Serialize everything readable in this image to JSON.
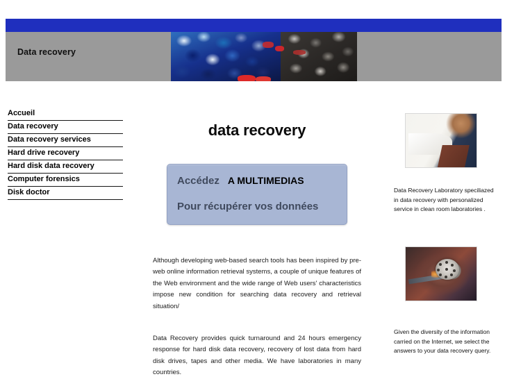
{
  "header": {
    "site_title": "Data recovery",
    "blue_bar_color": "#1f2fbe",
    "band_color": "#9a9a9a",
    "mosaic_image_name": "crowd-mosaic-banner"
  },
  "sidebar": {
    "items": [
      {
        "label": "Accueil"
      },
      {
        "label": "Data recovery"
      },
      {
        "label": "Data recovery services"
      },
      {
        "label": "Hard drive recovery"
      },
      {
        "label": "Hard disk data recovery"
      },
      {
        "label": "Computer forensics"
      },
      {
        "label": "Disk doctor"
      }
    ]
  },
  "main": {
    "title": "data recovery",
    "promo": {
      "line1_prefix": "Accédez",
      "line1_emphasis": "A  MULTIMEDIAS",
      "line2": "Pour récupérer vos données",
      "background_color": "#a8b6d4"
    },
    "paragraph_1": "Although developing web-based search tools has been inspired by pre-web online information retrieval systems, a couple of unique features of the Web environment and the wide range of Web users' characteristics impose new condition for searching data recovery and retrieval situation/",
    "paragraph_2": "Data Recovery provides quick turnaround and 24 hours emergency response for hard disk data recovery, recovery of lost data from hard disk drives, tapes and other media. We have laboratories in many countries."
  },
  "aside": {
    "figures": [
      {
        "image_name": "clean-room-technician-photo",
        "caption": "Data Recovery Laboratory speciliazed in data recovery with personalized service in clean room laboratories ."
      },
      {
        "image_name": "hard-disk-platter-photo",
        "caption": "Given the diversity of the information carried on the Internet, we select the answers to your data recovery query."
      }
    ]
  }
}
